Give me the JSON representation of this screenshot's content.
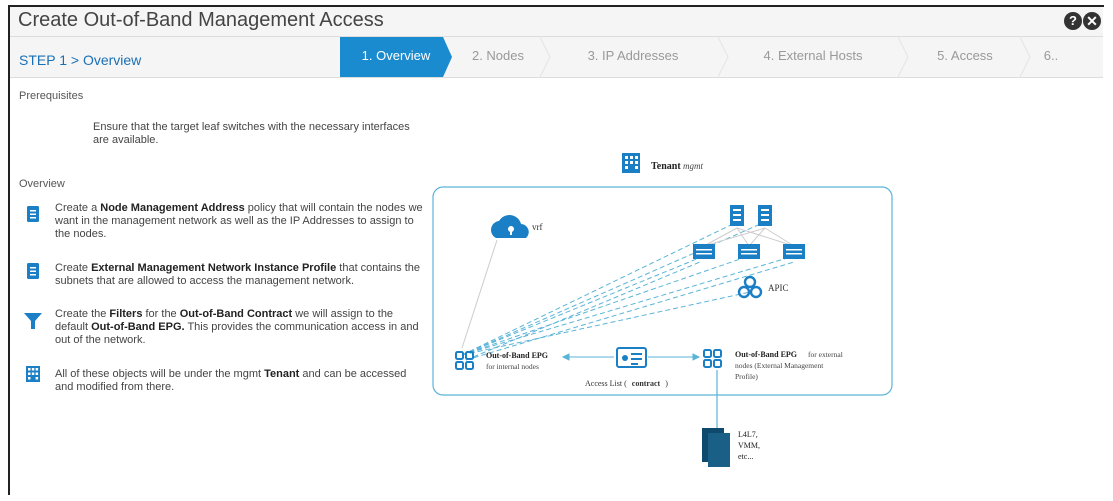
{
  "window": {
    "title": "Create Out-of-Band Management Access"
  },
  "stepper": {
    "current_label": "STEP 1 > Overview",
    "steps": [
      "1. Overview",
      "2. Nodes",
      "3. IP Addresses",
      "4. External Hosts",
      "5. Access",
      "6.."
    ],
    "active_index": 0
  },
  "prerequisites": {
    "heading": "Prerequisites",
    "text": "Ensure that the target leaf switches with the necessary interfaces are available."
  },
  "overview": {
    "heading": "Overview",
    "items": [
      {
        "icon": "policy-doc-icon",
        "pre": "Create a ",
        "bold1": "Node Management Address",
        "mid": " policy that will contain the nodes we want in the management network as well as the IP Addresses to assign to the nodes.",
        "bold2": "",
        "post": ""
      },
      {
        "icon": "profile-doc-icon",
        "pre": "Create ",
        "bold1": "External Management Network Instance Profile",
        "mid": " that contains the subnets that are allowed to access the management network.",
        "bold2": "",
        "post": ""
      },
      {
        "icon": "filter-icon",
        "pre": "Create the ",
        "bold1": "Filters",
        "mid": " for the ",
        "bold2": "Out-of-Band Contract",
        "post": " we will assign to the default ",
        "bold3": "Out-of-Band EPG.",
        "post2": " This provides the communication access in and out of the network."
      },
      {
        "icon": "tenant-grid-icon",
        "pre": "All of these objects will be under the mgmt ",
        "bold1": "Tenant",
        "mid": " and can be accessed and modified from there.",
        "bold2": "",
        "post": ""
      }
    ]
  },
  "diagram": {
    "tenant_label": "Tenant",
    "tenant_name": "mgmt",
    "vrf_label": "vrf",
    "apic_label": "APIC",
    "oob_epg_internal": "Out-of-Band EPG",
    "oob_epg_internal_sub": "for internal nodes",
    "oob_epg_external": "Out-of-Band EPG",
    "oob_epg_external_sub1": "for external",
    "oob_epg_external_sub2": "nodes (External Management",
    "oob_epg_external_sub3": "Profile)",
    "access_list_pre": "Access List (",
    "access_list_contract": "contract",
    "access_list_post": ")",
    "external_hosts_1": "L4L7,",
    "external_hosts_2": "VMM,",
    "external_hosts_3": "etc..."
  },
  "colors": {
    "accent": "#1b8bd0",
    "icon": "#1a7fc4",
    "dark_host": "#0d4a6e"
  }
}
